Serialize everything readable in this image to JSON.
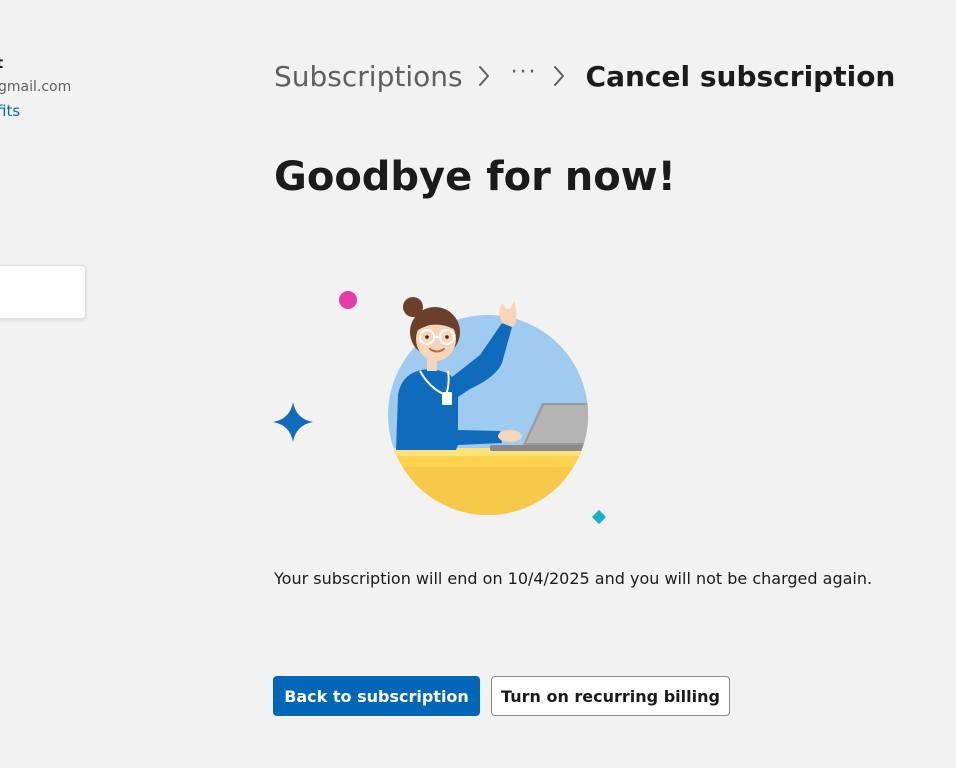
{
  "account": {
    "name_fragment": "t",
    "email_fragment": "gmail.com",
    "link_fragment": "fits"
  },
  "breadcrumb": {
    "root": "Subscriptions",
    "ellipsis": "···",
    "current": "Cancel subscription"
  },
  "page": {
    "title": "Goodbye for now!",
    "message": "Your subscription will end on 10/4/2025 and you will not be charged again."
  },
  "buttons": {
    "back_label": "Back to subscription",
    "recurring_label": "Turn on recurring billing"
  },
  "colors": {
    "accent": "#0067b8",
    "background": "#f2f2f2"
  },
  "icons": {
    "chevron": "chevron-right-icon",
    "illustration": "goodbye-illustration"
  }
}
